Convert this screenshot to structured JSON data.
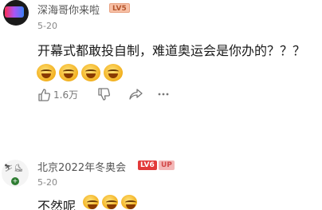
{
  "comments": [
    {
      "username": "深海哥你来啦",
      "level": "LV5",
      "date": "5-20",
      "text": "开幕式都敢投自制，难道奥运会是你办的？？？",
      "emoji_count": 4,
      "likes": "1.6万"
    },
    {
      "username": "北京2022年冬奥会",
      "level": "LV6",
      "tag": "UP",
      "date": "5-20",
      "text": "不然呢",
      "emoji_count": 3
    }
  ],
  "icons": {
    "like": "thumbs-up-icon",
    "dislike": "thumbs-down-icon",
    "share": "share-icon",
    "more": "more-icon"
  },
  "colors": {
    "level5": "#f7c0a6",
    "level6": "#e23a3a",
    "up_tag": "#f3b7b7",
    "muted_text": "#888888"
  }
}
